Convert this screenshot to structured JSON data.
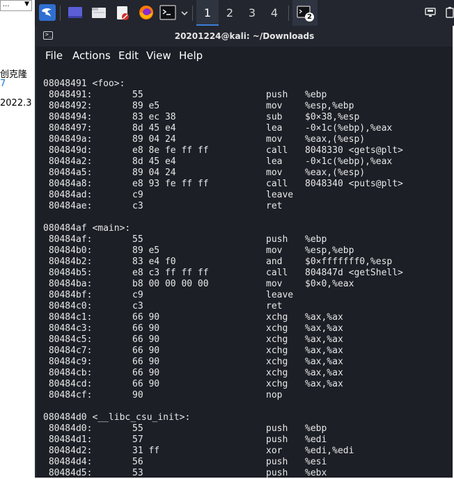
{
  "background_app": {
    "dropdown_value": "...",
    "text_line1": "创克隆",
    "text_line2": "7",
    "text_line3": "2022.3"
  },
  "panel": {
    "workspaces": [
      "1",
      "2",
      "3",
      "4"
    ],
    "active_workspace": 0,
    "badge_count": "2"
  },
  "window": {
    "title": "20201224@kali: ~/Downloads",
    "menu": [
      "File",
      "Actions",
      "Edit",
      "View",
      "Help"
    ]
  },
  "terminal": {
    "lines": [
      {
        "t": "label",
        "text": "08048491 <foo>:"
      },
      {
        "t": "ins",
        "addr": " 8048491:",
        "bytes": "55",
        "mn": "push",
        "op": "%ebp"
      },
      {
        "t": "ins",
        "addr": " 8048492:",
        "bytes": "89 e5",
        "mn": "mov",
        "op": "%esp,%ebp"
      },
      {
        "t": "ins",
        "addr": " 8048494:",
        "bytes": "83 ec 38",
        "mn": "sub",
        "op": "$0×38,%esp"
      },
      {
        "t": "ins",
        "addr": " 8048497:",
        "bytes": "8d 45 e4",
        "mn": "lea",
        "op": "-0×1c(%ebp),%eax"
      },
      {
        "t": "ins",
        "addr": " 804849a:",
        "bytes": "89 04 24",
        "mn": "mov",
        "op": "%eax,(%esp)"
      },
      {
        "t": "ins",
        "addr": " 804849d:",
        "bytes": "e8 8e fe ff ff",
        "mn": "call",
        "op": "8048330 <gets@plt>"
      },
      {
        "t": "ins",
        "addr": " 80484a2:",
        "bytes": "8d 45 e4",
        "mn": "lea",
        "op": "-0×1c(%ebp),%eax"
      },
      {
        "t": "ins",
        "addr": " 80484a5:",
        "bytes": "89 04 24",
        "mn": "mov",
        "op": "%eax,(%esp)"
      },
      {
        "t": "ins",
        "addr": " 80484a8:",
        "bytes": "e8 93 fe ff ff",
        "mn": "call",
        "op": "8048340 <puts@plt>"
      },
      {
        "t": "ins",
        "addr": " 80484ad:",
        "bytes": "c9",
        "mn": "leave",
        "op": ""
      },
      {
        "t": "ins",
        "addr": " 80484ae:",
        "bytes": "c3",
        "mn": "ret",
        "op": ""
      },
      {
        "t": "blank"
      },
      {
        "t": "label",
        "text": "080484af <main>:"
      },
      {
        "t": "ins",
        "addr": " 80484af:",
        "bytes": "55",
        "mn": "push",
        "op": "%ebp"
      },
      {
        "t": "ins",
        "addr": " 80484b0:",
        "bytes": "89 e5",
        "mn": "mov",
        "op": "%esp,%ebp"
      },
      {
        "t": "ins",
        "addr": " 80484b2:",
        "bytes": "83 e4 f0",
        "mn": "and",
        "op": "$0×fffffff0,%esp"
      },
      {
        "t": "ins",
        "addr": " 80484b5:",
        "bytes": "e8 c3 ff ff ff",
        "mn": "call",
        "op": "804847d <getShell>"
      },
      {
        "t": "ins",
        "addr": " 80484ba:",
        "bytes": "b8 00 00 00 00",
        "mn": "mov",
        "op": "$0×0,%eax"
      },
      {
        "t": "ins",
        "addr": " 80484bf:",
        "bytes": "c9",
        "mn": "leave",
        "op": ""
      },
      {
        "t": "ins",
        "addr": " 80484c0:",
        "bytes": "c3",
        "mn": "ret",
        "op": ""
      },
      {
        "t": "ins",
        "addr": " 80484c1:",
        "bytes": "66 90",
        "mn": "xchg",
        "op": "%ax,%ax"
      },
      {
        "t": "ins",
        "addr": " 80484c3:",
        "bytes": "66 90",
        "mn": "xchg",
        "op": "%ax,%ax"
      },
      {
        "t": "ins",
        "addr": " 80484c5:",
        "bytes": "66 90",
        "mn": "xchg",
        "op": "%ax,%ax"
      },
      {
        "t": "ins",
        "addr": " 80484c7:",
        "bytes": "66 90",
        "mn": "xchg",
        "op": "%ax,%ax"
      },
      {
        "t": "ins",
        "addr": " 80484c9:",
        "bytes": "66 90",
        "mn": "xchg",
        "op": "%ax,%ax"
      },
      {
        "t": "ins",
        "addr": " 80484cb:",
        "bytes": "66 90",
        "mn": "xchg",
        "op": "%ax,%ax"
      },
      {
        "t": "ins",
        "addr": " 80484cd:",
        "bytes": "66 90",
        "mn": "xchg",
        "op": "%ax,%ax"
      },
      {
        "t": "ins",
        "addr": " 80484cf:",
        "bytes": "90",
        "mn": "nop",
        "op": ""
      },
      {
        "t": "blank"
      },
      {
        "t": "label",
        "text": "080484d0 <__libc_csu_init>:"
      },
      {
        "t": "ins",
        "addr": " 80484d0:",
        "bytes": "55",
        "mn": "push",
        "op": "%ebp"
      },
      {
        "t": "ins",
        "addr": " 80484d1:",
        "bytes": "57",
        "mn": "push",
        "op": "%edi"
      },
      {
        "t": "ins",
        "addr": " 80484d2:",
        "bytes": "31 ff",
        "mn": "xor",
        "op": "%edi,%edi"
      },
      {
        "t": "ins",
        "addr": " 80484d4:",
        "bytes": "56",
        "mn": "push",
        "op": "%esi"
      },
      {
        "t": "ins",
        "addr": " 80484d5:",
        "bytes": "53",
        "mn": "push",
        "op": "%ebx"
      }
    ]
  }
}
